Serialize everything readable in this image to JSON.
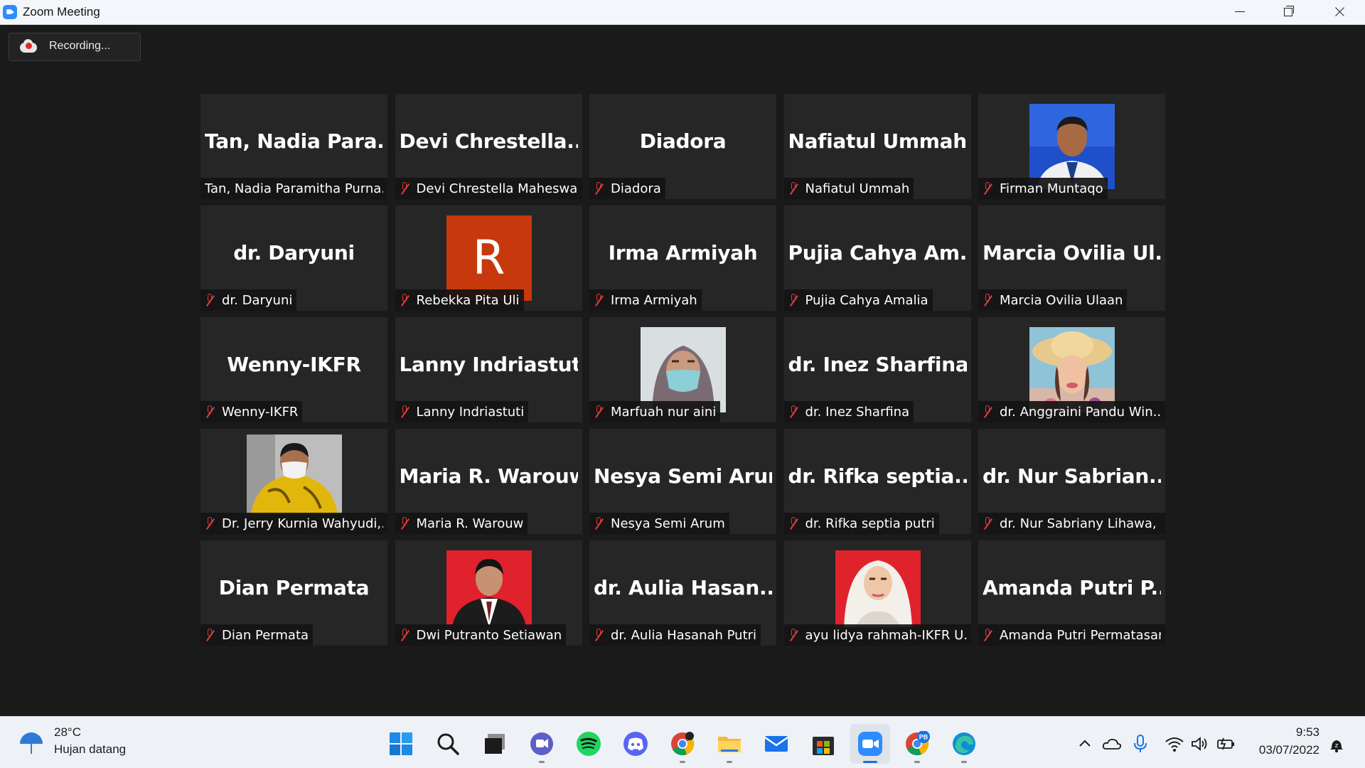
{
  "window": {
    "title": "Zoom Meeting"
  },
  "recording": {
    "label": "Recording..."
  },
  "participants": [
    {
      "display": "Tan,  Nadia  Para...",
      "label": "Tan, Nadia Paramitha Purna...",
      "muted": false,
      "type": "name"
    },
    {
      "display": "Devi  Chrestella...",
      "label": "Devi Chrestella Maheswa...",
      "muted": true,
      "type": "name"
    },
    {
      "display": "Diadora",
      "label": "Diadora",
      "muted": true,
      "type": "name"
    },
    {
      "display": "Nafiatul Ummah",
      "label": "Nafiatul Ummah",
      "muted": true,
      "type": "name"
    },
    {
      "display": "",
      "label": "Firman Muntaqo",
      "muted": true,
      "type": "photo-blue"
    },
    {
      "display": "dr. Daryuni",
      "label": "dr. Daryuni",
      "muted": true,
      "type": "name"
    },
    {
      "display": "R",
      "label": "Rebekka Pita Uli",
      "muted": true,
      "type": "letter"
    },
    {
      "display": "Irma Armiyah",
      "label": "Irma Armiyah",
      "muted": true,
      "type": "name"
    },
    {
      "display": "Pujia  Cahya  Am...",
      "label": "Pujia Cahya Amalia",
      "muted": true,
      "type": "name"
    },
    {
      "display": "Marcia  Ovilia  Ul...",
      "label": "Marcia Ovilia Ulaan",
      "muted": true,
      "type": "name"
    },
    {
      "display": "Wenny-IKFR",
      "label": "Wenny-IKFR",
      "muted": true,
      "type": "name"
    },
    {
      "display": "Lanny Indriastuti",
      "label": "Lanny Indriastuti",
      "muted": true,
      "type": "name"
    },
    {
      "display": "",
      "label": "Marfuah nur aini",
      "muted": true,
      "type": "photo-mask"
    },
    {
      "display": "dr. Inez Sharfina",
      "label": "dr. Inez Sharfina",
      "muted": true,
      "type": "name"
    },
    {
      "display": "",
      "label": "dr. Anggraini Pandu Win...",
      "muted": true,
      "type": "photo-hat"
    },
    {
      "display": "",
      "label": "Dr. Jerry Kurnia Wahyudi,...",
      "muted": true,
      "type": "photo-yellow"
    },
    {
      "display": "Maria R. Warouw",
      "label": "Maria R. Warouw",
      "muted": true,
      "type": "name"
    },
    {
      "display": "Nesya Semi Arum",
      "label": "Nesya Semi Arum",
      "muted": true,
      "type": "name"
    },
    {
      "display": "dr.  Rifka  septia...",
      "label": "dr. Rifka septia putri",
      "muted": true,
      "type": "name"
    },
    {
      "display": "dr.  Nur  Sabrian...",
      "label": "dr. Nur Sabriany Lihawa, ...",
      "muted": true,
      "type": "name"
    },
    {
      "display": "Dian Permata",
      "label": "Dian Permata",
      "muted": true,
      "type": "name"
    },
    {
      "display": "",
      "label": "Dwi Putranto Setiawan",
      "muted": true,
      "type": "photo-red-man"
    },
    {
      "display": "dr.  Aulia  Hasan...",
      "label": "dr. Aulia Hasanah Putri",
      "muted": true,
      "type": "name"
    },
    {
      "display": "",
      "label": "ayu lidya rahmah-IKFR U...",
      "muted": true,
      "type": "photo-red-hijab"
    },
    {
      "display": "Amanda  Putri  P...",
      "label": "Amanda Putri Permatasari",
      "muted": true,
      "type": "name"
    }
  ],
  "taskbar": {
    "weather_temp": "28°C",
    "weather_condition": "Hujan datang",
    "apps": [
      "windows-start",
      "search",
      "task-view",
      "teams-chat",
      "spotify",
      "discord",
      "chrome",
      "file-explorer",
      "mail",
      "microsoft-store",
      "zoom",
      "chrome-profile",
      "edge"
    ],
    "chrome_profile_badge": "PB",
    "time": "9:53",
    "date": "03/07/2022"
  }
}
